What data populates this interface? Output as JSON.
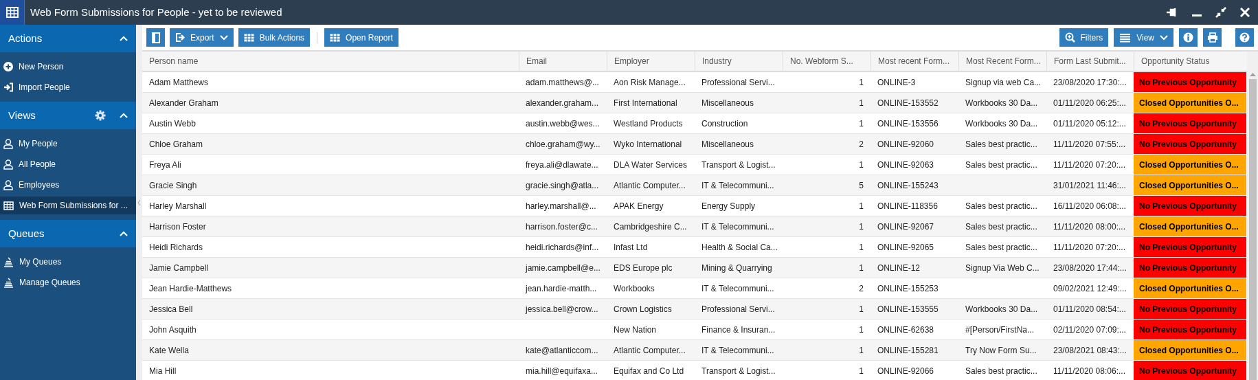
{
  "window": {
    "title": "Web Form Submissions for People - yet to be reviewed"
  },
  "sidebar": {
    "sections": [
      {
        "title": "Actions",
        "expanded": true,
        "items": [
          {
            "label": "New Person",
            "kind": "plus",
            "selected": false
          },
          {
            "label": "Import People",
            "kind": "import",
            "selected": false
          }
        ]
      },
      {
        "title": "Views",
        "expanded": true,
        "settings": true,
        "items": [
          {
            "label": "My People",
            "kind": "person",
            "selected": false
          },
          {
            "label": "All People",
            "kind": "person",
            "selected": false
          },
          {
            "label": "Employees",
            "kind": "person",
            "selected": false
          },
          {
            "label": "Web Form Submissions for ...",
            "kind": "grid",
            "selected": true
          }
        ]
      },
      {
        "title": "Queues",
        "expanded": true,
        "items": [
          {
            "label": "My Queues",
            "kind": "queue",
            "selected": false
          },
          {
            "label": "Manage Queues",
            "kind": "queue",
            "selected": false
          }
        ]
      }
    ]
  },
  "toolbar": {
    "left": [
      {
        "kind": "panel"
      },
      {
        "kind": "export",
        "label": "Export",
        "dropdown": true
      },
      {
        "kind": "grid",
        "label": "Bulk Actions"
      },
      {
        "kind": "separator"
      },
      {
        "kind": "grid",
        "label": "Open Report"
      }
    ],
    "right": [
      {
        "kind": "filter",
        "label": "Filters"
      },
      {
        "kind": "list",
        "label": "View",
        "dropdown": true
      },
      {
        "kind": "info"
      },
      {
        "kind": "print"
      },
      {
        "kind": "help"
      }
    ]
  },
  "table": {
    "columns": [
      "Person name",
      "Email",
      "Employer",
      "Industry",
      "No. Webform S...",
      "Most recent Form...",
      "Most Recent Form...",
      "Form Last Submit...",
      "Opportunity Status"
    ],
    "rows": [
      {
        "cells": [
          "Adam Matthews",
          "adam.matthews@...",
          "Aon Risk Manage...",
          "Professional Servi...",
          "1",
          "ONLINE-3",
          "Signup via web Ca...",
          "23/08/2020 17:30:..."
        ],
        "status": {
          "text": "No Previous Opportunity",
          "color": "#ff0000"
        }
      },
      {
        "cells": [
          "Alexander Graham",
          "alexander.graham...",
          "First International",
          "Miscellaneous",
          "1",
          "ONLINE-153552",
          "Workbooks 30 Da...",
          "01/11/2020 06:25:..."
        ],
        "status": {
          "text": "Closed Opportunities O...",
          "color": "#ffa500"
        }
      },
      {
        "cells": [
          "Austin Webb",
          "austin.webb@wes...",
          "Westland Products",
          "Construction",
          "1",
          "ONLINE-153556",
          "Workbooks 30 Da...",
          "01/11/2020 05:12:..."
        ],
        "status": {
          "text": "No Previous Opportunity",
          "color": "#ff0000"
        }
      },
      {
        "cells": [
          "Chloe Graham",
          "chloe.graham@wy...",
          "Wyko International",
          "Miscellaneous",
          "2",
          "ONLINE-92060",
          "Sales best practic...",
          "11/11/2020 07:55:..."
        ],
        "status": {
          "text": "No Previous Opportunity",
          "color": "#ff0000"
        }
      },
      {
        "cells": [
          "Freya Ali",
          "freya.ali@dlawate...",
          "DLA Water Services",
          "Transport & Logist...",
          "1",
          "ONLINE-92063",
          "Sales best practic...",
          "11/11/2020 07:20:..."
        ],
        "status": {
          "text": "Closed Opportunities O...",
          "color": "#ffa500"
        }
      },
      {
        "cells": [
          "Gracie Singh",
          "gracie.singh@atla...",
          "Atlantic Computer...",
          "IT & Telecommuni...",
          "5",
          "ONLINE-155243",
          "",
          "31/01/2021 11:46:..."
        ],
        "status": {
          "text": "Closed Opportunities O...",
          "color": "#ffa500"
        }
      },
      {
        "cells": [
          "Harley Marshall",
          "harley.marshall@...",
          "APAK Energy",
          "Energy Supply",
          "1",
          "ONLINE-118356",
          "Sales best practic...",
          "16/11/2020 06:08:..."
        ],
        "status": {
          "text": "No Previous Opportunity",
          "color": "#ff0000"
        }
      },
      {
        "cells": [
          "Harrison Foster",
          "harrison.foster@c...",
          "Cambridgeshire C...",
          "IT & Telecommuni...",
          "1",
          "ONLINE-92067",
          "Sales best practic...",
          "11/11/2020 08:00:..."
        ],
        "status": {
          "text": "Closed Opportunities O...",
          "color": "#ffa500"
        }
      },
      {
        "cells": [
          "Heidi Richards",
          "heidi.richards@inf...",
          "Infast Ltd",
          "Health & Social Ca...",
          "1",
          "ONLINE-92065",
          "Sales best practic...",
          "11/11/2020 07:20:..."
        ],
        "status": {
          "text": "No Previous Opportunity",
          "color": "#ff0000"
        }
      },
      {
        "cells": [
          "Jamie Campbell",
          "jamie.campbell@e...",
          "EDS Europe plc",
          "Mining & Quarrying",
          "1",
          "ONLINE-12",
          "Signup Via Web C...",
          "23/08/2020 17:44:..."
        ],
        "status": {
          "text": "No Previous Opportunity",
          "color": "#ff0000"
        }
      },
      {
        "cells": [
          "Jean Hardie-Matthews",
          "jean.hardie-matth...",
          "Workbooks",
          "IT & Telecommuni...",
          "2",
          "ONLINE-155253",
          "",
          "09/02/2021 12:49:..."
        ],
        "status": {
          "text": "Closed Opportunities O...",
          "color": "#ffa500"
        }
      },
      {
        "cells": [
          "Jessica Bell",
          "jessica.bell@crow...",
          "Crown Logistics",
          "Professional Servi...",
          "1",
          "ONLINE-153555",
          "Workbooks 30 Da...",
          "01/11/2020 08:54:..."
        ],
        "status": {
          "text": "No Previous Opportunity",
          "color": "#ff0000"
        }
      },
      {
        "cells": [
          "John Asquith",
          "",
          "New Nation",
          "Finance & Insuran...",
          "1",
          "ONLINE-62638",
          "#[Person/FirstNa...",
          "02/11/2020 07:09:..."
        ],
        "status": {
          "text": "No Previous Opportunity",
          "color": "#ff0000"
        }
      },
      {
        "cells": [
          "Kate Wella",
          "kate@atlanticcom...",
          "Atlantic Computer...",
          "IT & Telecommuni...",
          "1",
          "ONLINE-155281",
          "Try Now Form Su...",
          "23/08/2021 08:43:..."
        ],
        "status": {
          "text": "Closed Opportunities O...",
          "color": "#ffa500"
        }
      },
      {
        "cells": [
          "Mia Hill",
          "mia.hill@equifaxa...",
          "Equifax and Co Ltd",
          "Transport & Logist...",
          "1",
          "ONLINE-92066",
          "Sales best practic...",
          "11/11/2020 08:06:..."
        ],
        "status": {
          "text": "No Previous Opportunity",
          "color": "#ff0000"
        }
      }
    ]
  }
}
